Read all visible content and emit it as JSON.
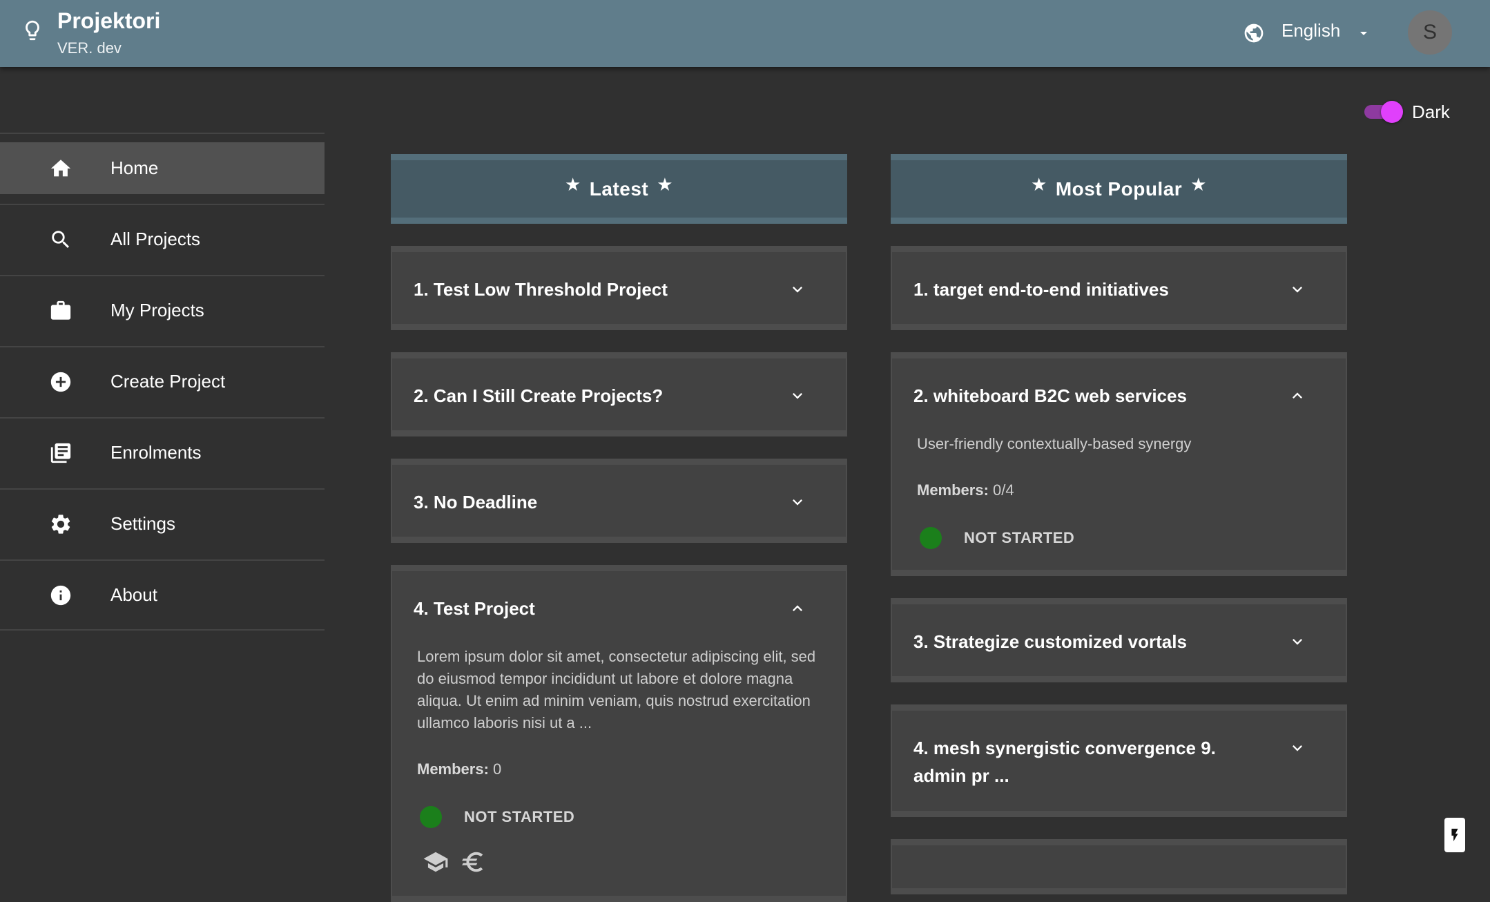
{
  "app": {
    "title": "Projektori",
    "version": "VER. dev"
  },
  "language": {
    "selected": "English"
  },
  "user": {
    "avatar_initial": "S"
  },
  "theme_toggle": {
    "label": "Dark",
    "enabled": true
  },
  "sidebar": {
    "items": [
      {
        "label": "Home",
        "icon": "home-icon",
        "active": true
      },
      {
        "label": "All Projects",
        "icon": "search-icon"
      },
      {
        "label": "My Projects",
        "icon": "briefcase-icon"
      },
      {
        "label": "Create Project",
        "icon": "add-circle-icon"
      },
      {
        "label": "Enrolments",
        "icon": "library-books-icon"
      },
      {
        "label": "Settings",
        "icon": "gear-icon"
      },
      {
        "label": "About",
        "icon": "info-icon"
      }
    ]
  },
  "latest": {
    "header": "Latest",
    "cards": [
      {
        "title": "1. Test Low Threshold Project",
        "expanded": false
      },
      {
        "title": "2. Can I Still Create Projects?",
        "expanded": false
      },
      {
        "title": "3. No Deadline",
        "expanded": false
      },
      {
        "title": "4. Test Project",
        "expanded": true,
        "description": "Lorem ipsum dolor sit amet, consectetur adipiscing elit, sed do eiusmod tempor incididunt ut labore et dolore magna aliqua. Ut enim ad minim veniam, quis nostrud exercitation ullamco laboris nisi ut a ...",
        "members_label": "Members:",
        "members_value": "0",
        "status": "NOT STARTED",
        "status_color": "#1b7f1b",
        "extra_icons": [
          "school-icon",
          "euro-icon"
        ]
      }
    ]
  },
  "popular": {
    "header": "Most Popular",
    "cards": [
      {
        "title": "1. target end-to-end initiatives",
        "expanded": false
      },
      {
        "title": "2. whiteboard B2C web services",
        "expanded": true,
        "description": "User-friendly contextually-based synergy",
        "members_label": "Members:",
        "members_value": "0/4",
        "status": "NOT STARTED",
        "status_color": "#1b7f1b"
      },
      {
        "title": "3. Strategize customized vortals",
        "expanded": false
      },
      {
        "title": "4. mesh synergistic convergence 9. admin pr ...",
        "expanded": false
      }
    ]
  },
  "colors": {
    "topbar": "#607d8b",
    "background": "#303030",
    "card": "#424242",
    "accent": "#e040fb",
    "column_header": "#455a64"
  }
}
